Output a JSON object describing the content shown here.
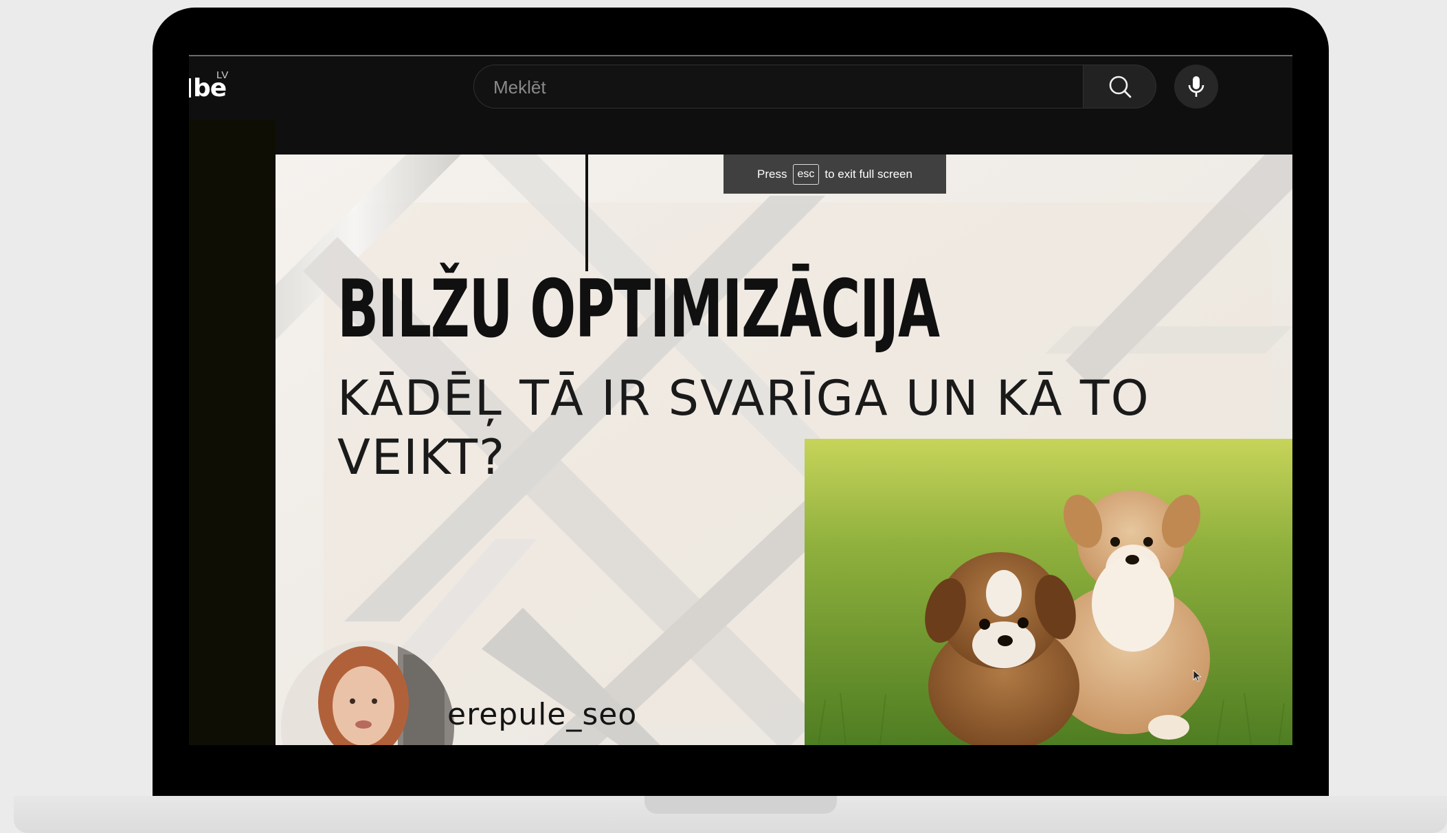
{
  "header": {
    "logo_text": "be",
    "country_code": "LV"
  },
  "search": {
    "placeholder": "Meklēt",
    "search_icon": "search-icon",
    "mic_icon": "mic-icon"
  },
  "video": {
    "fullscreen_hint": {
      "before": "Press",
      "key": "esc",
      "after": "to exit full screen"
    },
    "slide": {
      "title": "BILŽU OPTIMIZĀCIJA",
      "subtitle": "KĀDĒĻ TĀ IR SVARĪGA UN KĀ TO VEIKT?",
      "handle": "erepule_seo"
    }
  },
  "colors": {
    "background": "#ebebeb",
    "laptop_bezel": "#000000",
    "yt_dark": "#0f0f0f",
    "slide_bg": "#f3efea"
  }
}
